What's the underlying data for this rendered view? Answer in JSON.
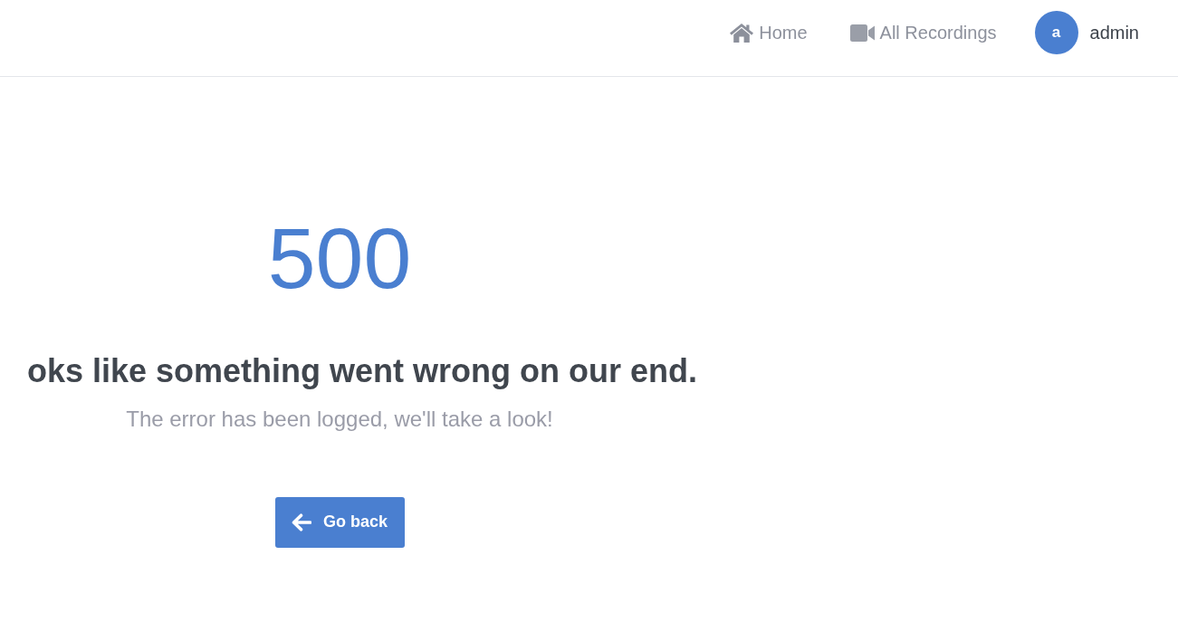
{
  "navbar": {
    "links": [
      {
        "label": "Home"
      },
      {
        "label": "All Recordings"
      }
    ],
    "user": {
      "avatar_letter": "a",
      "name": "admin"
    }
  },
  "error": {
    "code": "500",
    "heading": "oks like something went wrong on our end.",
    "message": "The error has been logged, we'll take a look!",
    "button": {
      "label": "Go back"
    }
  }
}
